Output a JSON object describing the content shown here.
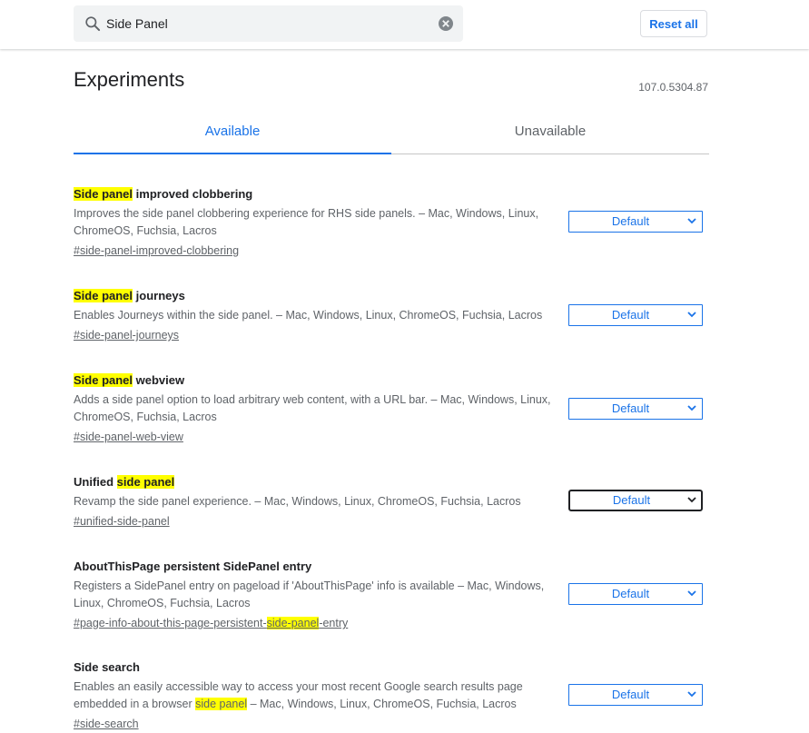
{
  "search": {
    "value": "Side Panel"
  },
  "reset_label": "Reset all",
  "title": "Experiments",
  "version": "107.0.5304.87",
  "tabs": {
    "available": "Available",
    "unavailable": "Unavailable"
  },
  "colors": {
    "accent": "#1a73e8",
    "highlight": "#ffff00"
  },
  "icons": {
    "search": "search-icon",
    "clear": "clear-icon",
    "dropdown": "chevron-down-icon"
  },
  "experiments": [
    {
      "name_hl": "Side panel",
      "name_rest": " improved clobbering",
      "desc": "Improves the side panel clobbering experience for RHS side panels. – Mac, Windows, Linux, ChromeOS, Fuchsia, Lacros",
      "link": "#side-panel-improved-clobbering",
      "select": "Default"
    },
    {
      "name_hl": "Side panel",
      "name_rest": " journeys",
      "desc": "Enables Journeys within the side panel. – Mac, Windows, Linux, ChromeOS, Fuchsia, Lacros",
      "link": "#side-panel-journeys",
      "select": "Default"
    },
    {
      "name_hl": "Side panel",
      "name_rest": " webview",
      "desc": "Adds a side panel option to load arbitrary web content, with a URL bar. – Mac, Windows, Linux, ChromeOS, Fuchsia, Lacros",
      "link": "#side-panel-web-view",
      "select": "Default"
    },
    {
      "name_pre": "Unified ",
      "name_hl": "side panel",
      "desc": "Revamp the side panel experience. – Mac, Windows, Linux, ChromeOS, Fuchsia, Lacros",
      "link": "#unified-side-panel",
      "select": "Default"
    },
    {
      "name": "AboutThisPage persistent SidePanel entry",
      "desc": "Registers a SidePanel entry on pageload if 'AboutThisPage' info is available – Mac, Windows, Linux, ChromeOS, Fuchsia, Lacros",
      "link_pre": "#page-info-about-this-page-persistent-",
      "link_hl": "side-panel",
      "link_post": "-entry",
      "select": "Default"
    },
    {
      "name": "Side search",
      "desc_pre": "Enables an easily accessible way to access your most recent Google search results page embedded in a browser ",
      "desc_hl": "side panel",
      "desc_post": " – Mac, Windows, Linux, ChromeOS, Fuchsia, Lacros",
      "link": "#side-search",
      "select": "Default"
    }
  ]
}
